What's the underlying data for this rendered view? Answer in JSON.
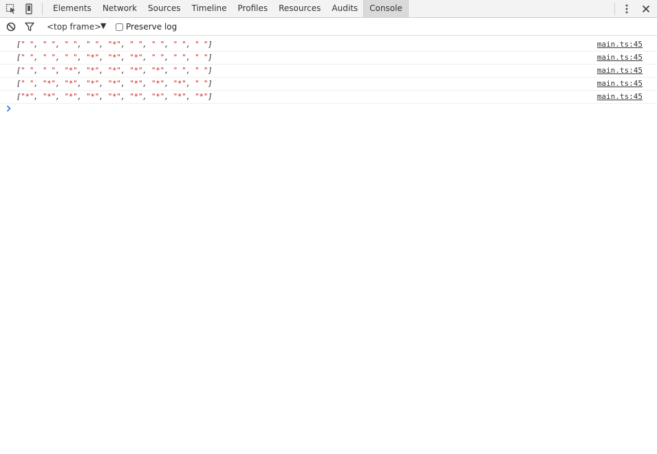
{
  "toolbar": {
    "tabs": [
      "Elements",
      "Network",
      "Sources",
      "Timeline",
      "Profiles",
      "Resources",
      "Audits",
      "Console"
    ],
    "selected_tab": "Console"
  },
  "filterbar": {
    "frame": "<top frame>",
    "preserve_log": "Preserve log",
    "preserve_log_checked": false
  },
  "console": {
    "messages": [
      {
        "values": [
          " ",
          " ",
          " ",
          " ",
          "*",
          " ",
          " ",
          " ",
          " "
        ],
        "source": "main.ts:45"
      },
      {
        "values": [
          " ",
          " ",
          " ",
          "*",
          "*",
          "*",
          " ",
          " ",
          " "
        ],
        "source": "main.ts:45"
      },
      {
        "values": [
          " ",
          " ",
          "*",
          "*",
          "*",
          "*",
          "*",
          " ",
          " "
        ],
        "source": "main.ts:45"
      },
      {
        "values": [
          " ",
          "*",
          "*",
          "*",
          "*",
          "*",
          "*",
          "*",
          " "
        ],
        "source": "main.ts:45"
      },
      {
        "values": [
          "*",
          "*",
          "*",
          "*",
          "*",
          "*",
          "*",
          "*",
          "*"
        ],
        "source": "main.ts:45"
      }
    ]
  },
  "colors": {
    "string": "#c41a16",
    "prompt": "#2a7ad2",
    "selected_tab_bg": "#dadada"
  }
}
